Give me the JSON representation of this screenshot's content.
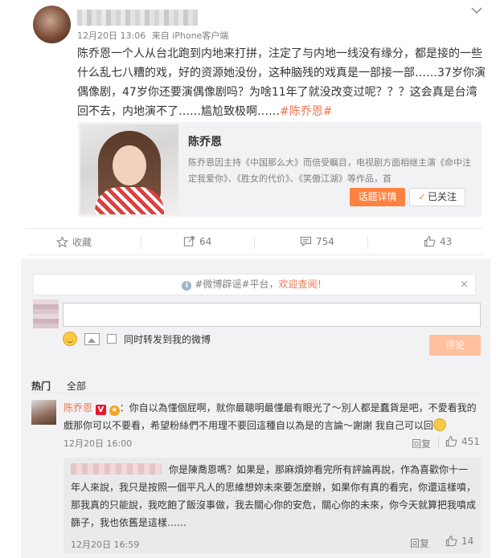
{
  "post": {
    "time": "12月20日 13:06",
    "source": "来自 iPhone客户端",
    "text": "陈乔恩一个人从台北跑到内地来打拼，注定了与内地一线没有缘分，都是接的一些什么乱七八糟的戏，好的资源她没份，这种脑残的戏真是一部接一部……37岁你演偶像剧，47岁你还要演偶像剧吗？为啥11年了就没改变过呢？？？这会真是台湾回不去，内地演不了……尴尬致极啊……",
    "topic": "#陈乔恩#"
  },
  "card": {
    "title": "陈乔恩",
    "desc": "陈乔恩因主持《中国那么大》而倍受瞩目，电视剧方面相继主演《命中注定我爱你》、《胜女的代价》、《笑傲江湖》等作品，首",
    "topic_btn": "话题详情",
    "follow_btn": "已关注"
  },
  "actions": {
    "favorite": "收藏",
    "repost": "64",
    "comments": "754",
    "likes": "43"
  },
  "notice": {
    "prefix": "#微博辟谣#平台，",
    "highlight": "欢迎查阅！",
    "close": "×"
  },
  "composer": {
    "also_repost": "同时转发到我的微博",
    "submit": "评论"
  },
  "tabs": {
    "hot": "热门",
    "all": "全部"
  },
  "comments": [
    {
      "user": "陈乔恩",
      "text": "：你自以為懂個屁啊，就你最聰明最懂最有眼光了～別人都是蠢貨是吧，不愛看我的戲那你可以不要看，希望粉絲們不用理不要回這種自以為是的言論～謝謝 我自己可以回",
      "time": "12月20日 16:00",
      "reply": "回复",
      "likes": "451"
    }
  ],
  "reply": {
    "text": "你是陳喬恩嗎？如果是，那麻煩妳看完所有評論再說，作為喜歡你十一年人來說，我只是按照一個平凡人的思維想妳未來要怎麼辦，如果你有真的看完，你還這樣噴，那我真的只能說，我吃飽了飯沒事做，我去關心你的安危，關心你的未來，你今天就算把我噴成篩子，我也依舊是這樣……",
    "time": "12月20日 16:59",
    "reply_label": "回复",
    "likes": "14"
  }
}
